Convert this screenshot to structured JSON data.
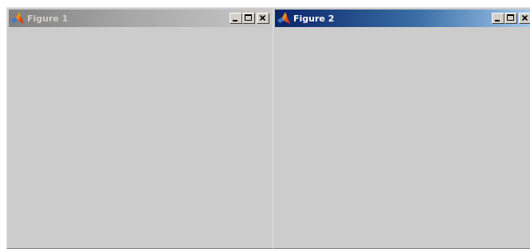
{
  "windows": [
    {
      "title": "Figure 1",
      "state": "inactive",
      "icon": "matlab-figure-icon",
      "controls": [
        "minimize-icon",
        "maximize-icon",
        "close-icon"
      ]
    },
    {
      "title": "Figure 2",
      "state": "active",
      "icon": "matlab-figure-icon",
      "controls": [
        "minimize-icon",
        "maximize-icon",
        "close-icon"
      ]
    }
  ],
  "colors": {
    "client_background": "#cccccc",
    "active_title_start": "#0a246a",
    "active_title_end": "#a6caf0",
    "inactive_title_start": "#808080",
    "inactive_title_end": "#c8c8c8"
  }
}
